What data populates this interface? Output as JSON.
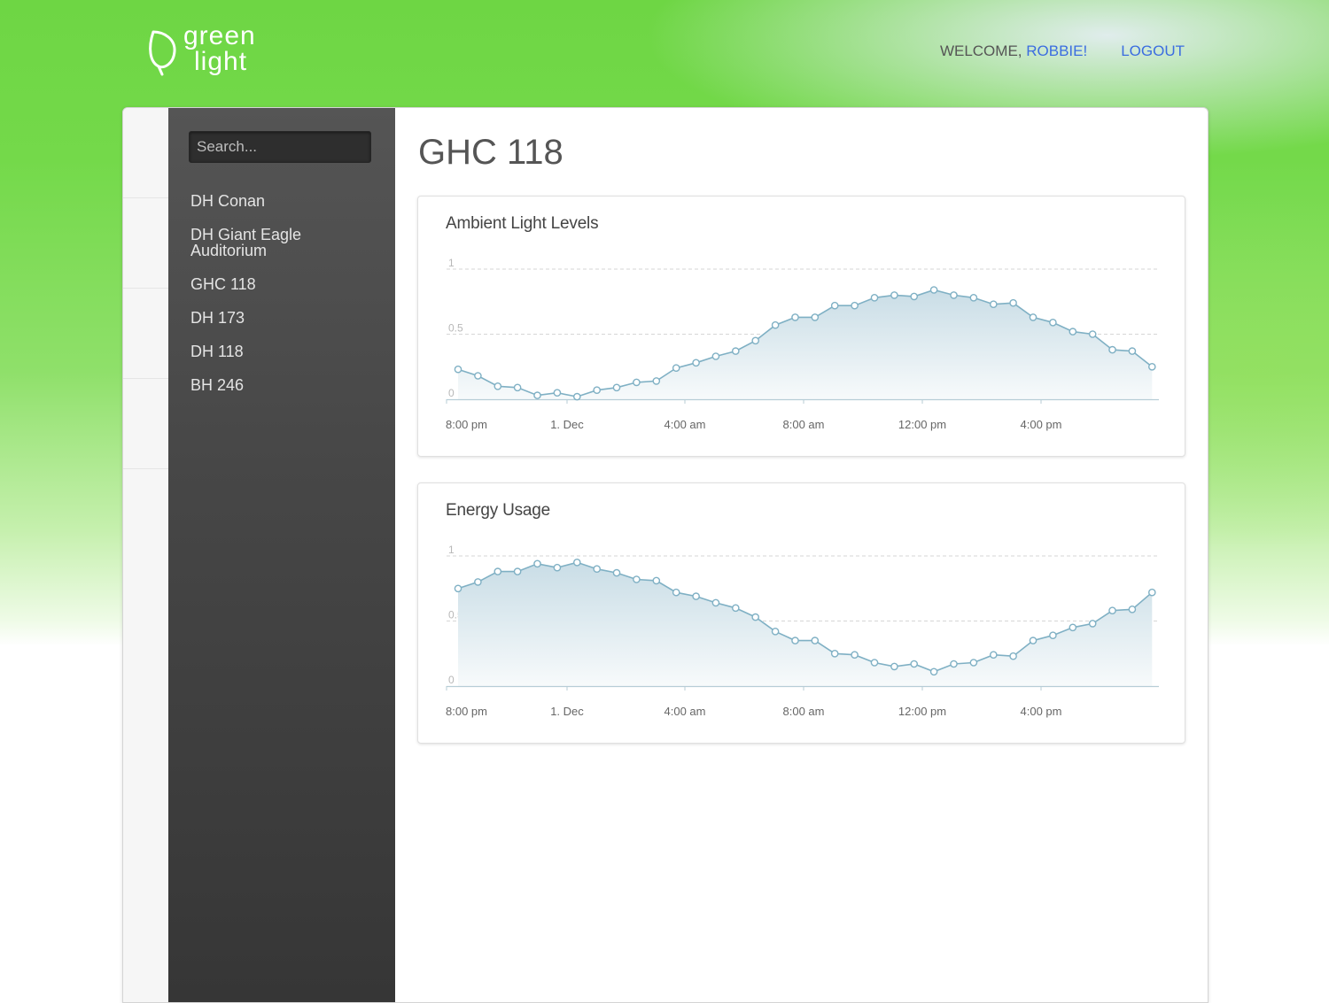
{
  "header": {
    "logo": {
      "line1": "green",
      "line2": "light",
      "icon": "leaf-icon"
    },
    "welcome_label": "WELCOME, ",
    "user_name": "ROBBIE!",
    "logout_label": "LOGOUT"
  },
  "sidebar": {
    "search_placeholder": "Search...",
    "rooms": [
      "DH Conan",
      "DH Giant Eagle Auditorium",
      "GHC 118",
      "DH 173",
      "DH 118",
      "BH 246"
    ]
  },
  "main": {
    "title": "GHC 118"
  },
  "colors": {
    "accent": "#3b6de0",
    "series_line": "#7fb0c4",
    "series_fill_top": "#c9dde6",
    "brand_green": "#6ed644"
  },
  "chart_data": [
    {
      "type": "area",
      "title": "Ambient Light Levels",
      "xlabel": "",
      "ylabel": "",
      "ylim": [
        0,
        1
      ],
      "yticks": [
        "0",
        "0.5",
        "1"
      ],
      "xticks": [
        "8:00 pm",
        "1. Dec",
        "4:00 am",
        "8:00 am",
        "12:00 pm",
        "4:00 pm"
      ],
      "grid": true,
      "legend": "none",
      "series": [
        {
          "values": [
            0.23,
            0.18,
            0.1,
            0.09,
            0.03,
            0.05,
            0.02,
            0.07,
            0.09,
            0.13,
            0.14,
            0.24,
            0.28,
            0.33,
            0.37,
            0.45,
            0.57,
            0.63,
            0.63,
            0.72,
            0.72,
            0.78,
            0.8,
            0.79,
            0.84,
            0.8,
            0.78,
            0.73,
            0.74,
            0.63,
            0.59,
            0.52,
            0.5,
            0.38,
            0.37,
            0.25
          ]
        }
      ]
    },
    {
      "type": "area",
      "title": "Energy Usage",
      "xlabel": "",
      "ylabel": "",
      "ylim": [
        0,
        1
      ],
      "yticks": [
        "0",
        "0.5",
        "1"
      ],
      "xticks": [
        "8:00 pm",
        "1. Dec",
        "4:00 am",
        "8:00 am",
        "12:00 pm",
        "4:00 pm"
      ],
      "grid": true,
      "legend": "none",
      "series": [
        {
          "values": [
            0.75,
            0.8,
            0.88,
            0.88,
            0.94,
            0.91,
            0.95,
            0.9,
            0.87,
            0.82,
            0.81,
            0.72,
            0.69,
            0.64,
            0.6,
            0.53,
            0.42,
            0.35,
            0.35,
            0.25,
            0.24,
            0.18,
            0.15,
            0.17,
            0.11,
            0.17,
            0.18,
            0.24,
            0.23,
            0.35,
            0.39,
            0.45,
            0.48,
            0.58,
            0.59,
            0.72
          ]
        }
      ]
    }
  ]
}
